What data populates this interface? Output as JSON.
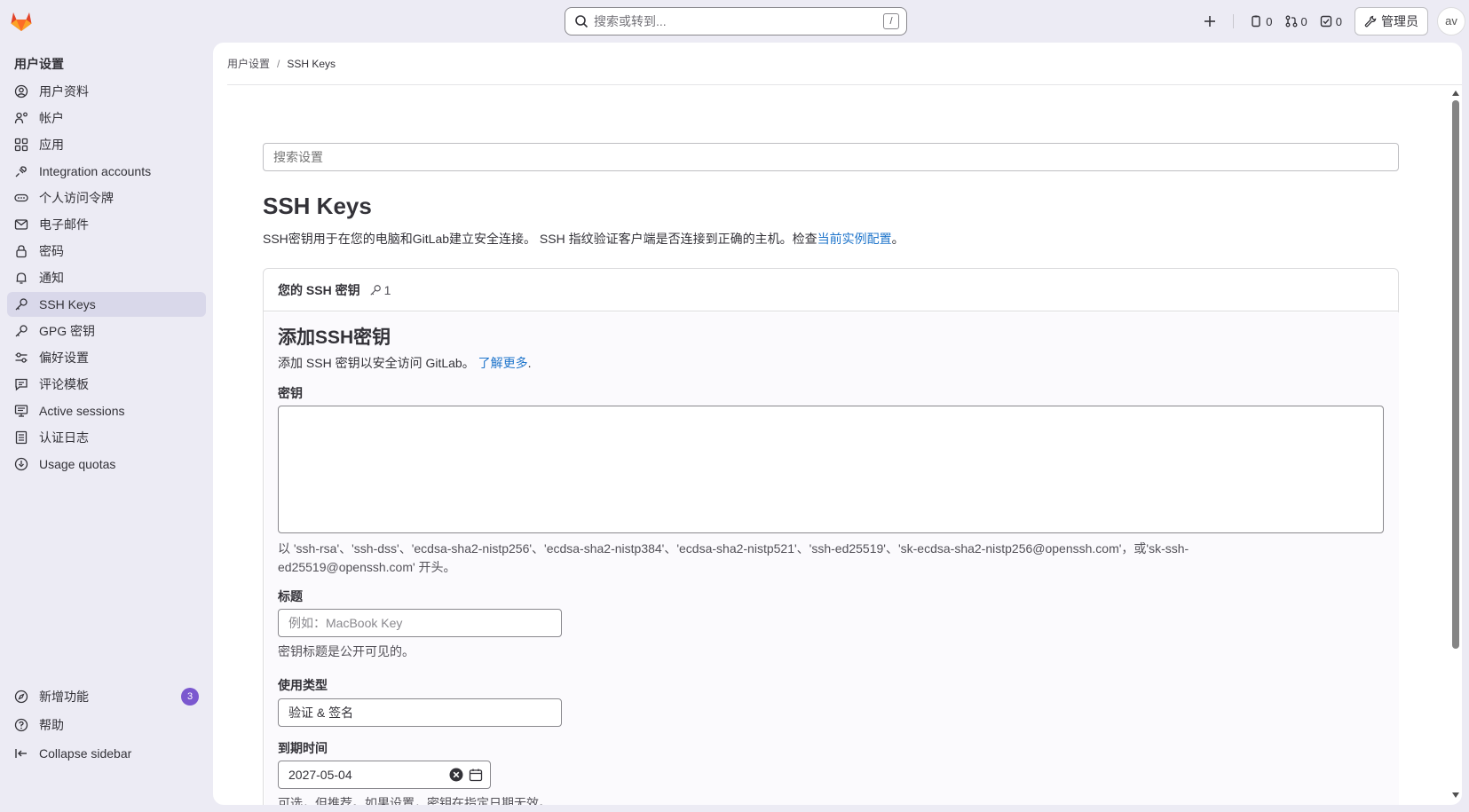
{
  "topbar": {
    "search_placeholder": "搜索或转到...",
    "search_shortcut": "/",
    "issues_count": "0",
    "mr_count": "0",
    "todos_count": "0",
    "admin_label": "管理员",
    "avatar_alt": "av"
  },
  "sidebar": {
    "title": "用户设置",
    "items": [
      {
        "label": "用户资料",
        "icon": "user-circle-icon"
      },
      {
        "label": "帐户",
        "icon": "account-icon"
      },
      {
        "label": "应用",
        "icon": "applications-icon"
      },
      {
        "label": "Integration accounts",
        "icon": "plug-icon"
      },
      {
        "label": "个人访问令牌",
        "icon": "token-icon"
      },
      {
        "label": "电子邮件",
        "icon": "mail-icon"
      },
      {
        "label": "密码",
        "icon": "lock-icon"
      },
      {
        "label": "通知",
        "icon": "bell-icon"
      },
      {
        "label": "SSH Keys",
        "icon": "key-icon",
        "active": true
      },
      {
        "label": "GPG 密钥",
        "icon": "key-icon"
      },
      {
        "label": "偏好设置",
        "icon": "preferences-icon"
      },
      {
        "label": "评论模板",
        "icon": "comment-icon"
      },
      {
        "label": "Active sessions",
        "icon": "monitor-icon"
      },
      {
        "label": "认证日志",
        "icon": "log-icon"
      },
      {
        "label": "Usage quotas",
        "icon": "quota-icon"
      }
    ],
    "whats_new": "新增功能",
    "whats_new_badge": "3",
    "help": "帮助",
    "collapse": "Collapse sidebar"
  },
  "breadcrumb": {
    "parent": "用户设置",
    "current": "SSH Keys"
  },
  "page": {
    "settings_search_placeholder": "搜索设置",
    "title": "SSH Keys",
    "description": "SSH密钥用于在您的电脑和GitLab建立安全连接。 SSH 指纹验证客户端是否连接到正确的主机。检查",
    "description_link": "当前实例配置",
    "description_end": "。"
  },
  "card": {
    "header": "您的 SSH 密钥",
    "key_count": "1",
    "add_title": "添加SSH密钥",
    "add_desc": "添加 SSH 密钥以安全访问 GitLab。",
    "learn_more": "了解更多",
    "learn_more_end": ".",
    "key_label": "密钥",
    "key_help_line1": "以 'ssh-rsa'、'ssh-dss'、'ecdsa-sha2-nistp256'、'ecdsa-sha2-nistp384'、'ecdsa-sha2-nistp521'、'ssh-ed25519'、'sk-ecdsa-sha2-nistp256@openssh.com'，或'sk-ssh-",
    "key_help_line2": "ed25519@openssh.com' 开头。",
    "title_label": "标题",
    "title_placeholder": "例如：MacBook Key",
    "title_help": "密钥标题是公开可见的。",
    "usage_label": "使用类型",
    "usage_value": "验证 & 签名",
    "expiry_label": "到期时间",
    "expiry_value": "2027-05-04",
    "expiry_help": "可选，但推荐。如果设置，密钥在指定日期无效。"
  },
  "colors": {
    "accent_link": "#1f75cb",
    "active_nav": "#d9d8ea",
    "badge": "#7b58cf",
    "sidebar_bg": "#ecebf4"
  }
}
